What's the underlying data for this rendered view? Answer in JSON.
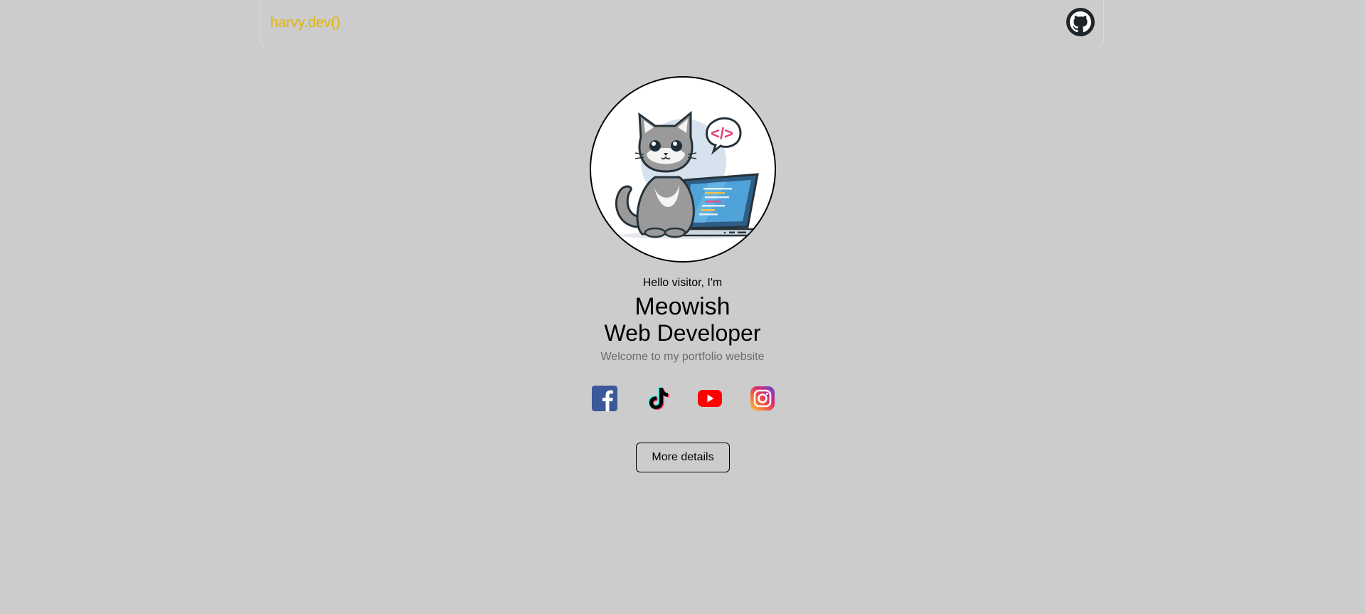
{
  "navbar": {
    "brand": "harvy.dev()",
    "github_icon": "github-icon"
  },
  "hero": {
    "avatar_icon": "cat-developer-illustration",
    "greeting": "Hello visitor, I'm",
    "name": "Meowish",
    "role": "Web Developer",
    "welcome": "Welcome to my portfolio website",
    "socials": [
      {
        "name": "facebook-icon",
        "color": "#3b5998"
      },
      {
        "name": "tiktok-icon",
        "color": "#000000"
      },
      {
        "name": "youtube-icon",
        "color": "#ff0000"
      },
      {
        "name": "instagram-icon",
        "color": "#e1306c"
      }
    ],
    "more_button": "More details"
  },
  "colors": {
    "background": "#cccccc",
    "brand": "#e2b500",
    "muted_text": "#6b6b6b"
  }
}
